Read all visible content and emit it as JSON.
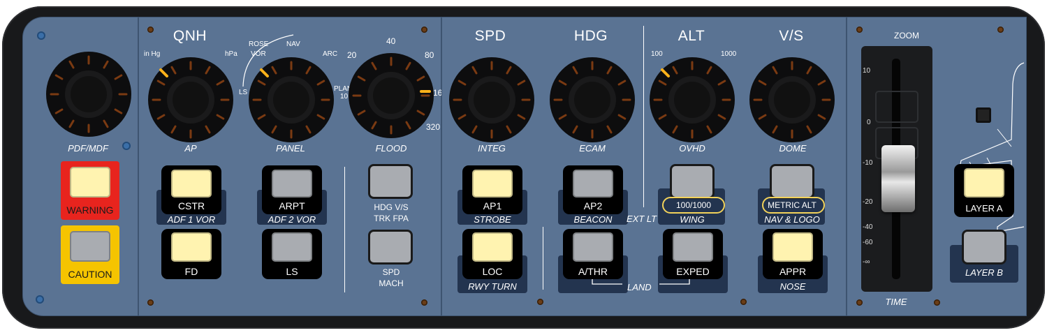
{
  "panel_1": {
    "knob_label": "PDF/MDF",
    "warning": "WARNING",
    "caution": "CAUTION"
  },
  "panel_2": {
    "qnh": "QNH",
    "qnh_left": "in Hg",
    "qnh_right": "hPa",
    "mode_rose": "ROSE",
    "mode_nav": "NAV",
    "mode_vor": "VOR",
    "mode_arc": "ARC",
    "mode_ls": "LS",
    "mode_plan": "PLAN",
    "range": [
      "10",
      "20",
      "40",
      "80",
      "160",
      "320"
    ],
    "knob_labels": [
      "AP",
      "PANEL",
      "FLOOD"
    ],
    "buttons": [
      {
        "label": "CSTR",
        "sub": "ADF 1 VOR",
        "lit": true
      },
      {
        "label": "ARPT",
        "sub": "ADF 2 VOR",
        "lit": false
      },
      {
        "label": "FD",
        "sub": "",
        "lit": true
      },
      {
        "label": "LS",
        "sub": "",
        "lit": false
      }
    ],
    "hdg_vs": "HDG V/S",
    "trk_fpa": "TRK FPA",
    "spd": "SPD",
    "mach": "MACH"
  },
  "panel_3": {
    "titles": [
      "SPD",
      "HDG",
      "ALT",
      "V/S"
    ],
    "alt_left": "100",
    "alt_right": "1000",
    "knob_labels": [
      "INTEG",
      "ECAM",
      "OVHD",
      "DOME"
    ],
    "buttons_top": [
      {
        "label": "AP1",
        "sub": "STROBE",
        "lit": true
      },
      {
        "label": "AP2",
        "sub": "BEACON",
        "lit": false
      },
      {
        "label": "100/1000",
        "sub": "WING",
        "lit": false
      },
      {
        "label": "METRIC ALT",
        "sub": "NAV & LOGO",
        "lit": false
      }
    ],
    "buttons_bottom": [
      {
        "label": "LOC",
        "sub": "RWY TURN",
        "lit": true
      },
      {
        "label": "A/THR",
        "sub": "",
        "lit": false
      },
      {
        "label": "EXPED",
        "sub": "",
        "lit": false
      },
      {
        "label": "APPR",
        "sub": "NOSE",
        "lit": true
      }
    ],
    "ext_lt": "EXT LT",
    "land": "LAND"
  },
  "panel_4": {
    "zoom": "ZOOM",
    "time": "TIME",
    "scale": [
      "10",
      "0",
      "-10",
      "-20",
      "-40",
      "-60",
      "-∞"
    ],
    "layer_a": "LAYER A",
    "layer_b": "LAYER B"
  },
  "colors": {
    "panel": "#5a7393",
    "warning": "#e8241e",
    "caution": "#f5c400",
    "lit": "#fff3b0",
    "unlit": "#a9acb1"
  }
}
